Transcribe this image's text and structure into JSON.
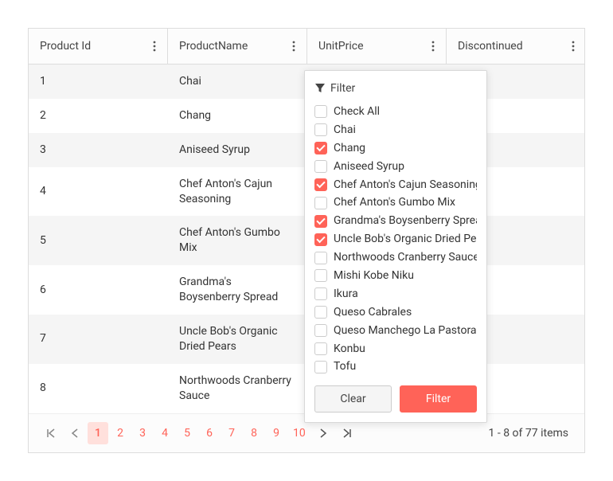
{
  "grid": {
    "columns": [
      {
        "key": "id",
        "label": "Product Id"
      },
      {
        "key": "name",
        "label": "ProductName"
      },
      {
        "key": "price",
        "label": "UnitPrice"
      },
      {
        "key": "disc",
        "label": "Discontinued"
      }
    ],
    "rows": [
      {
        "id": "1",
        "name": "Chai"
      },
      {
        "id": "2",
        "name": "Chang"
      },
      {
        "id": "3",
        "name": "Aniseed Syrup"
      },
      {
        "id": "4",
        "name": "Chef Anton's Cajun Seasoning"
      },
      {
        "id": "5",
        "name": "Chef Anton's Gumbo Mix"
      },
      {
        "id": "6",
        "name": "Grandma's Boysenberry Spread"
      },
      {
        "id": "7",
        "name": "Uncle Bob's Organic Dried Pears"
      },
      {
        "id": "8",
        "name": "Northwoods Cranberry Sauce"
      }
    ]
  },
  "filter": {
    "title": "Filter",
    "clear_label": "Clear",
    "filter_label": "Filter",
    "items": [
      {
        "label": "Check All",
        "checked": false
      },
      {
        "label": "Chai",
        "checked": false
      },
      {
        "label": "Chang",
        "checked": true
      },
      {
        "label": "Aniseed Syrup",
        "checked": false
      },
      {
        "label": "Chef Anton's Cajun Seasoning",
        "checked": true
      },
      {
        "label": "Chef Anton's Gumbo Mix",
        "checked": false
      },
      {
        "label": "Grandma's Boysenberry Spread",
        "checked": true
      },
      {
        "label": "Uncle Bob's Organic Dried Pears",
        "checked": true
      },
      {
        "label": "Northwoods Cranberry Sauce",
        "checked": false
      },
      {
        "label": "Mishi Kobe Niku",
        "checked": false
      },
      {
        "label": "Ikura",
        "checked": false
      },
      {
        "label": "Queso Cabrales",
        "checked": false
      },
      {
        "label": "Queso Manchego La Pastora",
        "checked": false
      },
      {
        "label": "Konbu",
        "checked": false
      },
      {
        "label": "Tofu",
        "checked": false
      }
    ]
  },
  "pager": {
    "pages": [
      "1",
      "2",
      "3",
      "4",
      "5",
      "6",
      "7",
      "8",
      "9",
      "10"
    ],
    "active": "1",
    "info": "1 - 8 of 77 items"
  }
}
